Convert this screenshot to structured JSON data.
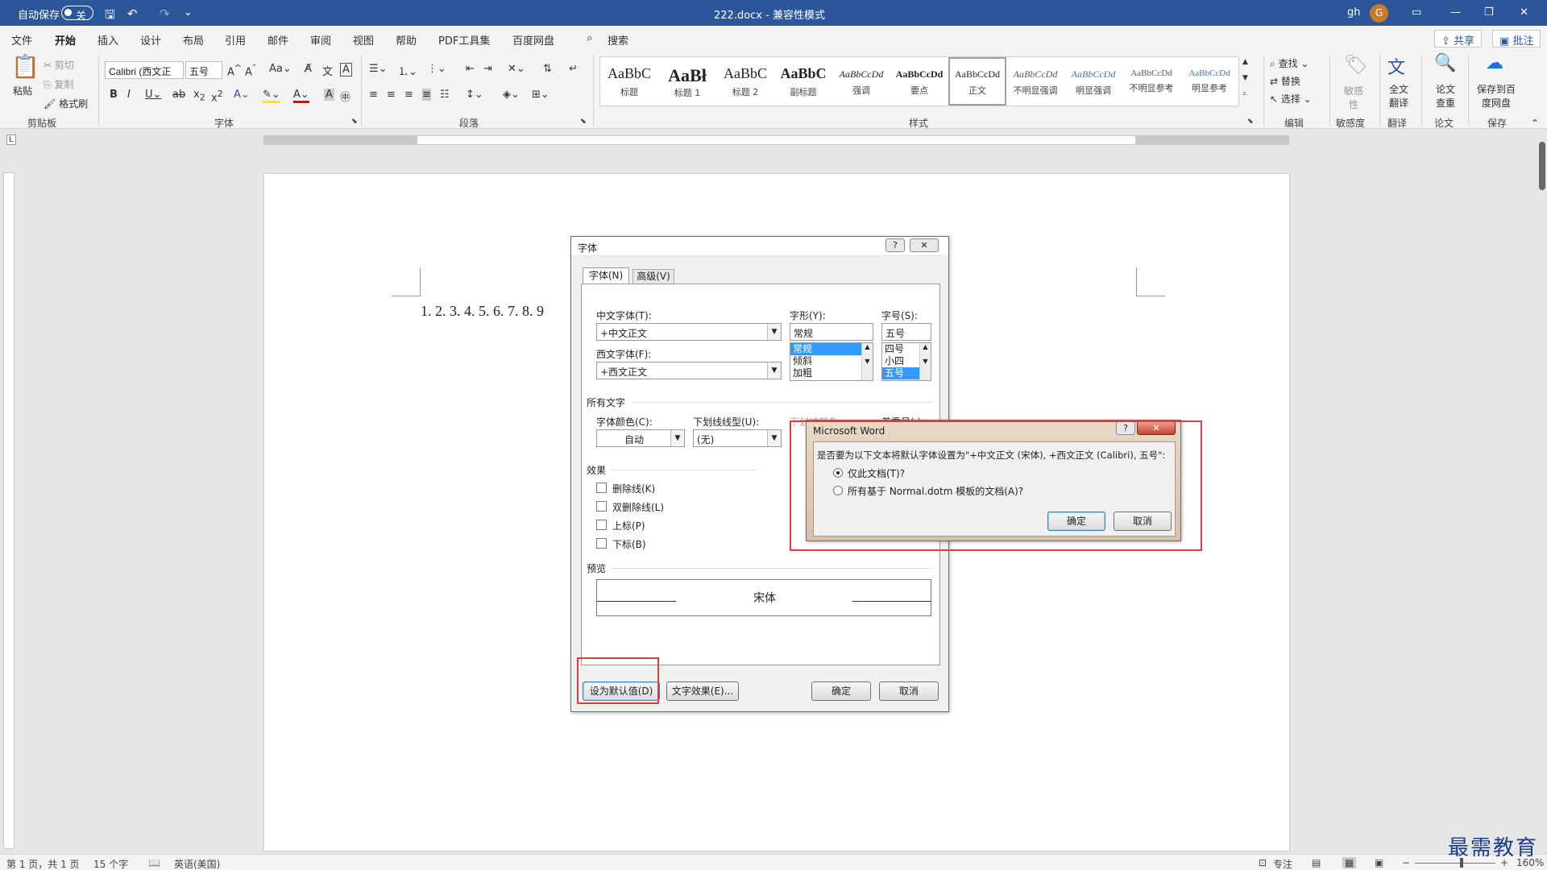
{
  "titlebar": {
    "autosave_label": "自动保存",
    "autosave_state": "关",
    "doc_title": "222.docx  -  兼容性模式",
    "user_name": "gh",
    "avatar_initial": "G"
  },
  "ribbon_tabs": [
    "文件",
    "开始",
    "插入",
    "设计",
    "布局",
    "引用",
    "邮件",
    "审阅",
    "视图",
    "帮助",
    "PDF工具集",
    "百度网盘"
  ],
  "search_label": "搜索",
  "share_label": "共享",
  "comment_label": "批注",
  "clipboard": {
    "paste": "粘贴",
    "cut": "剪切",
    "copy": "复制",
    "format_painter": "格式刷",
    "group": "剪贴板"
  },
  "font_group": {
    "font_name": "Calibri (西文正",
    "font_size": "五号",
    "group": "字体"
  },
  "paragraph_group": {
    "group": "段落"
  },
  "styles_group": {
    "group": "样式",
    "items": [
      {
        "sample": "AaBbC",
        "name": "标题"
      },
      {
        "sample": "AaBł",
        "name": "标题 1"
      },
      {
        "sample": "AaBbC",
        "name": "标题 2"
      },
      {
        "sample": "AaBbC",
        "name": "副标题"
      },
      {
        "sample": "AaBbCcDd",
        "name": "强调"
      },
      {
        "sample": "AaBbCcDd",
        "name": "要点"
      },
      {
        "sample": "AaBbCcDd",
        "name": "正文"
      },
      {
        "sample": "AaBbCcDd",
        "name": "不明显强调"
      },
      {
        "sample": "AaBbCcDd",
        "name": "明显强调"
      },
      {
        "sample": "AaBbCcDd",
        "name": "不明显参考"
      },
      {
        "sample": "AaBbCcDd",
        "name": "明显参考"
      }
    ]
  },
  "editing_group": {
    "find": "查找",
    "replace": "替换",
    "select": "选择",
    "group": "编辑"
  },
  "sensitivity_group": {
    "button": "敏感性",
    "group": "敏感度"
  },
  "translate_group": {
    "button": "全文翻译",
    "group": "翻译"
  },
  "paper_group": {
    "button": "论文查重",
    "group": "论文"
  },
  "save_group": {
    "button": "保存到百度网盘",
    "group": "保存"
  },
  "document": {
    "text": "1. 2. 3. 4. 5. 6. 7. 8. 9"
  },
  "font_dialog": {
    "title": "字体",
    "tabs": [
      "字体(N)",
      "高级(V)"
    ],
    "cn_font_label": "中文字体(T):",
    "cn_font_value": "+中文正文",
    "west_font_label": "西文字体(F):",
    "west_font_value": "+西文正文",
    "style_label": "字形(Y):",
    "style_value": "常规",
    "style_options": [
      "常规",
      "倾斜",
      "加粗"
    ],
    "size_label": "字号(S):",
    "size_value": "五号",
    "size_options": [
      "四号",
      "小四",
      "五号"
    ],
    "all_text_label": "所有文字",
    "color_label": "字体颜色(C):",
    "color_value": "自动",
    "underline_label": "下划线线型(U):",
    "underline_value": "(无)",
    "underline_color_label": "下划线颜色",
    "emphasis_label": "着重号(·)",
    "effects_label": "效果",
    "effects": [
      "删除线(K)",
      "双删除线(L)",
      "上标(P)",
      "下标(B)"
    ],
    "preview_label": "预览",
    "preview_text": "宋体",
    "set_default_btn": "设为默认值(D)",
    "text_effects_btn": "文字效果(E)...",
    "ok_btn": "确定",
    "cancel_btn": "取消"
  },
  "confirm_dialog": {
    "title": "Microsoft Word",
    "question": "是否要为以下文本将默认字体设置为\"+中文正文 (宋体), +西文正文 (Calibri), 五号\":",
    "option1": "仅此文档(T)?",
    "option2": "所有基于 Normal.dotm 模板的文档(A)?",
    "ok_btn": "确定",
    "cancel_btn": "取消"
  },
  "statusbar": {
    "page": "第 1 页，共 1 页",
    "words": "15 个字",
    "language": "英语(美国)",
    "focus": "专注",
    "zoom": "160%"
  },
  "watermark": "最需教育",
  "colors": {
    "title_bar": "#2b579a",
    "highlight_box": "#e23b3b",
    "selection": "#3399ff"
  }
}
